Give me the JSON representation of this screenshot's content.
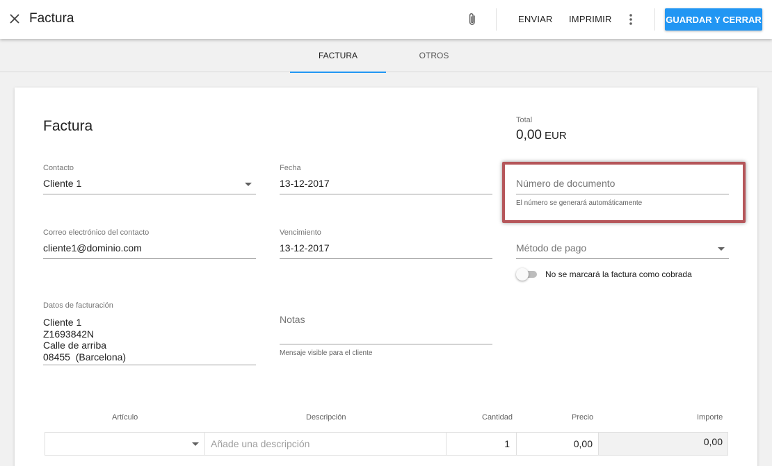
{
  "header": {
    "title": "Factura",
    "send_label": "ENVIAR",
    "print_label": "IMPRIMIR",
    "save_close_label": "GUARDAR Y CERRAR"
  },
  "tabs": [
    {
      "label": "FACTURA",
      "active": true
    },
    {
      "label": "OTROS",
      "active": false
    }
  ],
  "form": {
    "title": "Factura",
    "total": {
      "label": "Total",
      "amount": "0,00",
      "currency": "EUR"
    },
    "contact": {
      "label": "Contacto",
      "value": "Cliente 1"
    },
    "date": {
      "label": "Fecha",
      "value": "13-12-2017"
    },
    "doc_number": {
      "placeholder": "Número de documento",
      "helper": "El número se generará automáticamente"
    },
    "email": {
      "label": "Correo electrónico del contacto",
      "value": "cliente1@dominio.com"
    },
    "due_date": {
      "label": "Vencimiento",
      "value": "13-12-2017"
    },
    "payment_method": {
      "placeholder": "Método de pago"
    },
    "paid_toggle": {
      "label": "No se marcará la factura como cobrada",
      "on": false
    },
    "billing": {
      "label": "Datos de facturación",
      "lines": [
        "Cliente 1",
        "Z1693842N",
        "Calle de arriba",
        "08455  (Barcelona)"
      ]
    },
    "notes": {
      "placeholder": "Notas",
      "helper": "Mensaje visible para el cliente"
    }
  },
  "items_table": {
    "headers": {
      "article": "Artículo",
      "description": "Descripción",
      "quantity": "Cantidad",
      "price": "Precio",
      "amount": "Importe"
    },
    "rows": [
      {
        "article": "",
        "description_placeholder": "Añade una descripción",
        "quantity": "1",
        "price": "0,00",
        "amount": "0,00"
      }
    ]
  },
  "colors": {
    "accent": "#2196f3",
    "highlight": "#b5565a"
  },
  "icons": {
    "close": "close-icon",
    "attach": "paperclip-icon",
    "more": "more-vert-icon",
    "dropdown": "caret-down-icon"
  }
}
